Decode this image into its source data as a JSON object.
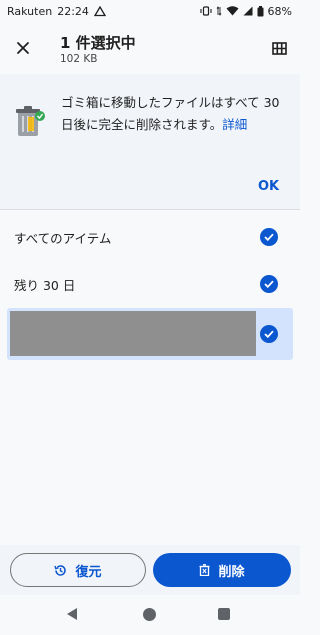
{
  "status_bar": {
    "carrier": "Rakuten",
    "time": "22:24",
    "battery": "68%"
  },
  "appbar": {
    "title": "1 件選択中",
    "subtitle": "102 KB"
  },
  "banner": {
    "message": "ゴミ箱に移動したファイルはすべて 30 日後に完全に削除されます。",
    "link": "詳細",
    "ok_label": "OK"
  },
  "list": {
    "items": [
      {
        "label": "すべてのアイテム",
        "checked": true
      },
      {
        "label": "残り 30 日",
        "checked": true
      },
      {
        "label": "",
        "checked": true,
        "redacted": true
      }
    ]
  },
  "actions": {
    "restore_label": "復元",
    "delete_label": "削除"
  },
  "colors": {
    "accent": "#0b57d0",
    "selected_bg": "#d3e3fd"
  },
  "icons": {
    "close": "close-icon",
    "grid": "grid-view-icon",
    "restore": "history-icon",
    "delete": "delete-icon"
  }
}
